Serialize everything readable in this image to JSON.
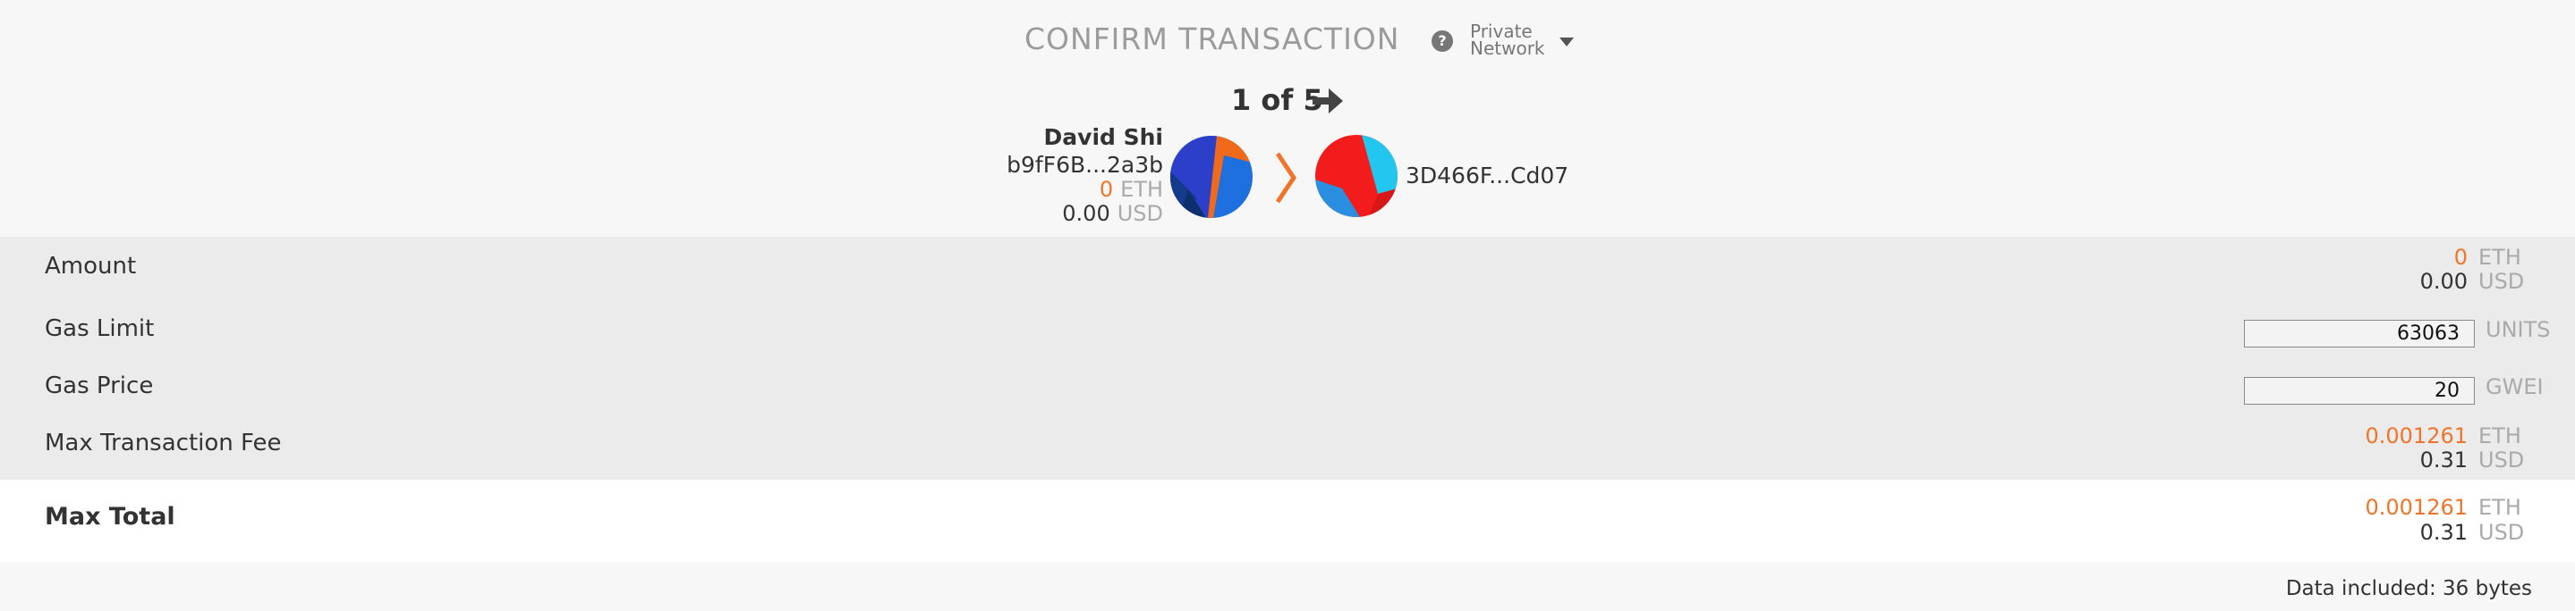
{
  "header": {
    "title": "CONFIRM TRANSACTION",
    "help_icon": "question-circle-icon",
    "network_line1": "Private",
    "network_line2": "Network",
    "network_dropdown_icon": "caret-down-icon"
  },
  "pager": {
    "label": "1 of 5",
    "next_icon": "arrow-right-icon"
  },
  "sender": {
    "name": "David Shi",
    "address": "b9fF6B...2a3b",
    "eth_value": "0",
    "eth_unit": "ETH",
    "usd_value": "0.00",
    "usd_unit": "USD"
  },
  "recipient": {
    "address": "3D466F...Cd07"
  },
  "rows": {
    "amount": {
      "label": "Amount",
      "eth_value": "0",
      "eth_unit": "ETH",
      "usd_value": "0.00",
      "usd_unit": "USD"
    },
    "gas_limit": {
      "label": "Gas Limit",
      "value": "63063",
      "unit": "UNITS"
    },
    "gas_price": {
      "label": "Gas Price",
      "value": "20",
      "unit": "GWEI"
    },
    "max_fee": {
      "label": "Max Transaction Fee",
      "eth_value": "0.001261",
      "eth_unit": "ETH",
      "usd_value": "0.31",
      "usd_unit": "USD"
    }
  },
  "total": {
    "label": "Max Total",
    "eth_value": "0.001261",
    "eth_unit": "ETH",
    "usd_value": "0.31",
    "usd_unit": "USD"
  },
  "footer": {
    "data_note": "Data included: 36 bytes"
  },
  "colors": {
    "accent_orange": "#f0752b",
    "header_bg": "#f7f7f7",
    "details_bg": "#ebebeb",
    "total_bg": "#ffffff"
  }
}
